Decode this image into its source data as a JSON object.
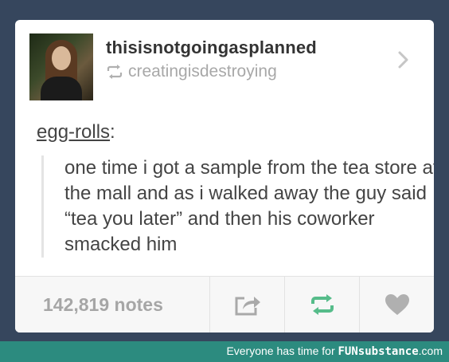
{
  "post": {
    "username": "thisisnotgoingasplanned",
    "reblogged_from": "creatingisdestroying",
    "source_user": "egg-rolls",
    "source_separator": ":",
    "quote": "one time i got a sample from the tea store at the mall and as i walked away the guy said “tea you later” and then his coworker smacked him"
  },
  "footer": {
    "notes": "142,819 notes",
    "actions": [
      "share-icon",
      "reblog-icon",
      "like-icon"
    ]
  },
  "watermark": {
    "text": "Everyone has time for ",
    "brand": "FUNsubstance",
    "suffix": ".com"
  },
  "colors": {
    "background": "#36465d",
    "reblog_green": "#56bc8a",
    "watermark_bar": "#2c8b7f"
  }
}
